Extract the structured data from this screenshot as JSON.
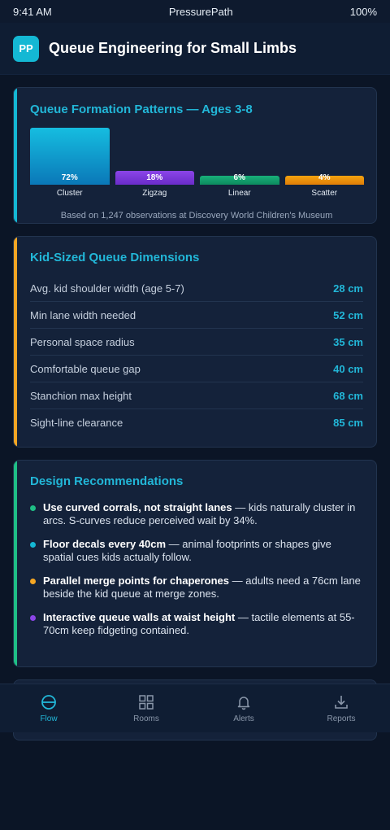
{
  "status": {
    "time": "9:41 AM",
    "carrier": "PressurePath",
    "battery": "100%"
  },
  "app": {
    "logo": "PP",
    "title": "Queue Engineering for Small Limbs"
  },
  "chart_card": {
    "accent": "#14b8d4",
    "title": "Queue Formation Patterns — Ages 3-8",
    "note": "Based on 1,247 observations at Discovery World Children's Museum"
  },
  "chart_data": {
    "type": "bar",
    "title": "Queue Formation Patterns — Ages 3-8",
    "categories": [
      "Cluster",
      "Zigzag",
      "Linear",
      "Scatter"
    ],
    "values": [
      72,
      18,
      6,
      4
    ],
    "value_labels": [
      "72%",
      "18%",
      "6%",
      "4%"
    ],
    "colors": [
      [
        "#16bde0",
        "#0a78b8"
      ],
      [
        "#8b45e8",
        "#6a2cc9"
      ],
      [
        "#19b07a",
        "#0d8a5e"
      ],
      [
        "#f5a30f",
        "#e07e08"
      ]
    ],
    "ylim": [
      0,
      72
    ]
  },
  "dims_card": {
    "accent": "#f5a623",
    "title": "Kid-Sized Queue Dimensions",
    "rows": [
      {
        "label": "Avg. kid shoulder width (age 5-7)",
        "value": "28 cm"
      },
      {
        "label": "Min lane width needed",
        "value": "52 cm"
      },
      {
        "label": "Personal space radius",
        "value": "35 cm"
      },
      {
        "label": "Comfortable queue gap",
        "value": "40 cm"
      },
      {
        "label": "Stanchion max height",
        "value": "68 cm"
      },
      {
        "label": "Sight-line clearance",
        "value": "85 cm"
      }
    ]
  },
  "recs_card": {
    "accent": "#1fbf86",
    "title": "Design Recommendations",
    "items": [
      {
        "color": "#1fbf86",
        "bold": "Use curved corrals, not straight lanes",
        "text": " — kids naturally cluster in arcs. S-curves reduce perceived wait by 34%."
      },
      {
        "color": "#14b8d4",
        "bold": "Floor decals every 40cm",
        "text": " — animal footprints or shapes give spatial cues kids actually follow."
      },
      {
        "color": "#f5a623",
        "bold": "Parallel merge points for chaperones",
        "text": " — adults need a 76cm lane beside the kid queue at merge zones."
      },
      {
        "color": "#8b45e8",
        "bold": "Interactive queue walls at waist height",
        "text": " — tactile elements at 55-70cm keep fidgeting contained."
      }
    ]
  },
  "nav": {
    "items": [
      {
        "label": "Flow",
        "icon": "flow-icon",
        "active": true
      },
      {
        "label": "Rooms",
        "icon": "grid-icon",
        "active": false
      },
      {
        "label": "Alerts",
        "icon": "bell-icon",
        "active": false
      },
      {
        "label": "Reports",
        "icon": "download-icon",
        "active": false
      }
    ]
  }
}
